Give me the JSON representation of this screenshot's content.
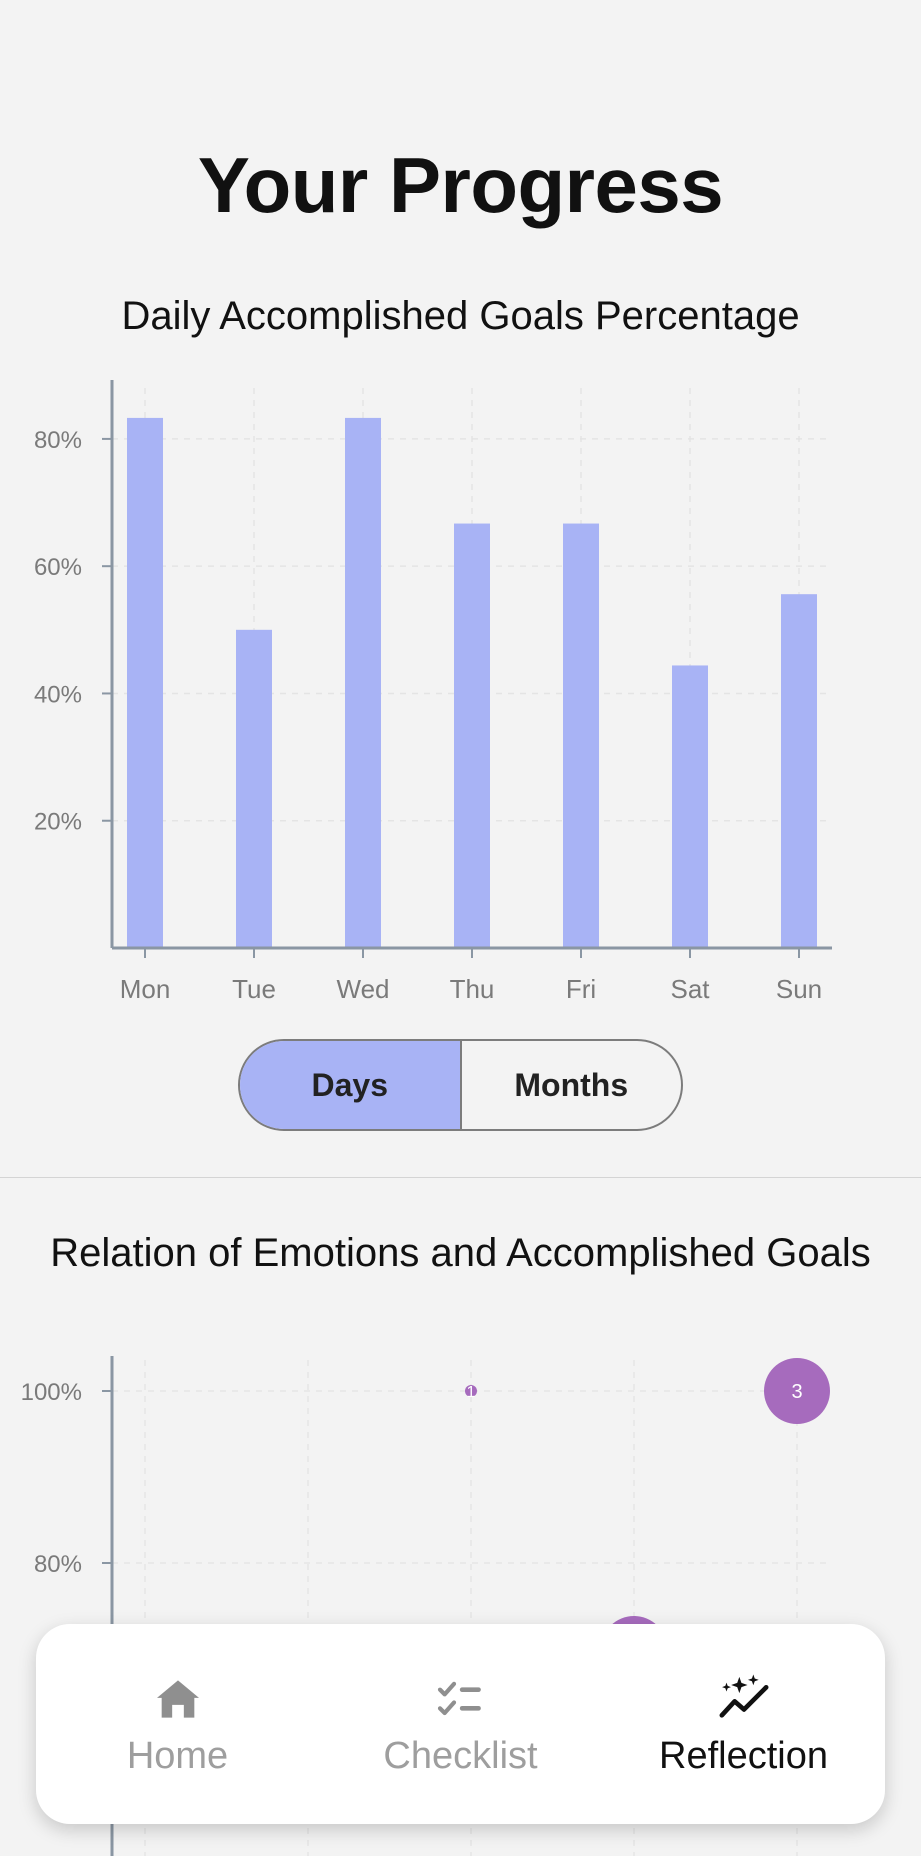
{
  "header": {
    "title": "Your Progress"
  },
  "bar_chart": {
    "title": "Daily Accomplished Goals Percentage",
    "bar_color": "#a8b3f5",
    "axis_color": "#8a96a3",
    "y_ticks": [
      "20%",
      "40%",
      "60%",
      "80%"
    ]
  },
  "toggle": {
    "options": [
      {
        "label": "Days",
        "active": true
      },
      {
        "label": "Months",
        "active": false
      }
    ],
    "active_color": "#a8b3f5"
  },
  "bubble_chart": {
    "title": "Relation of Emotions and Accomplished Goals",
    "bubble_color": "#a66bbd",
    "y_ticks": [
      "80%",
      "100%"
    ]
  },
  "bottom_nav": {
    "items": [
      {
        "label": "Home",
        "icon": "home-icon",
        "active": false
      },
      {
        "label": "Checklist",
        "icon": "checklist-icon",
        "active": false
      },
      {
        "label": "Reflection",
        "icon": "sparkle-chart-icon",
        "active": true
      }
    ]
  },
  "chart_data": [
    {
      "type": "bar",
      "title": "Daily Accomplished Goals Percentage",
      "categories": [
        "Mon",
        "Tue",
        "Wed",
        "Thu",
        "Fri",
        "Sat",
        "Sun"
      ],
      "values": [
        83.3,
        50,
        83.3,
        66.7,
        66.7,
        44.4,
        55.6
      ],
      "xlabel": "",
      "ylabel": "",
      "ylim": [
        0,
        88
      ],
      "y_ticks": [
        20,
        40,
        60,
        80
      ],
      "grid": true
    },
    {
      "type": "scatter",
      "title": "Relation of Emotions and Accomplished Goals",
      "points": [
        {
          "x": 3,
          "y": 100,
          "count": 1,
          "label": "1"
        },
        {
          "x": 5,
          "y": 100,
          "count": 3,
          "label": "3"
        },
        {
          "x": 4,
          "y": 70,
          "count": 3,
          "label": ""
        }
      ],
      "xlabel": "",
      "ylabel": "",
      "y_ticks": [
        80,
        100
      ],
      "grid": true
    }
  ]
}
